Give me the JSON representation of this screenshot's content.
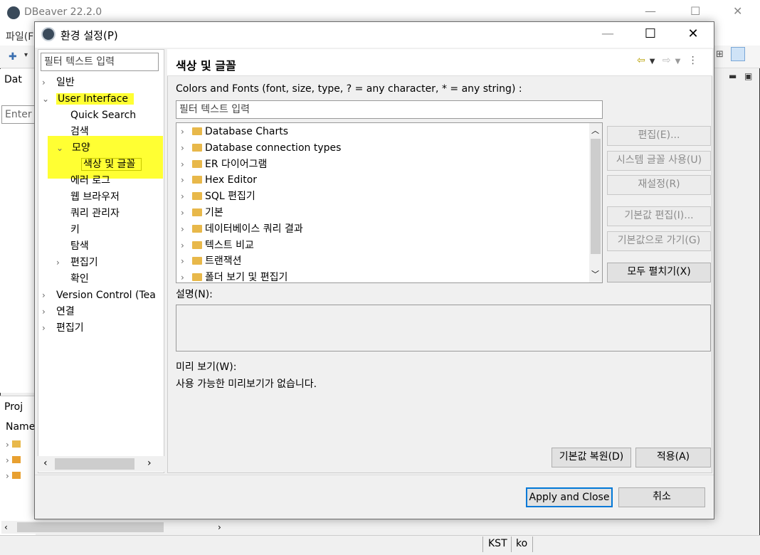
{
  "app": {
    "title": "DBeaver 22.2.0",
    "menu_file": "파일(F",
    "left_tab": "Dat",
    "left_filter_placeholder": "Enter a",
    "projects_tab": "Proj",
    "name_col": "Name",
    "status_kst": "KST",
    "status_ko": "ko"
  },
  "dialog": {
    "title": "환경 설정(P)",
    "controls": {
      "minimize": "—",
      "maximize": "☐",
      "close": "✕"
    }
  },
  "tree": {
    "filter_placeholder": "필터 텍스트 입력",
    "items": [
      {
        "label": "일반",
        "chev": "›",
        "indent": 0
      },
      {
        "label": "User Interface",
        "chev": "⌄",
        "indent": 0
      },
      {
        "label": "Quick Search",
        "chev": "",
        "indent": 1
      },
      {
        "label": "검색",
        "chev": "",
        "indent": 1
      },
      {
        "label": "모양",
        "chev": "⌄",
        "indent": 1
      },
      {
        "label": "색상 및 글꼴",
        "chev": "",
        "indent": 2
      },
      {
        "label": "에러 로그",
        "chev": "",
        "indent": 1
      },
      {
        "label": "웹 브라우저",
        "chev": "",
        "indent": 1
      },
      {
        "label": "쿼리 관리자",
        "chev": "",
        "indent": 1
      },
      {
        "label": "키",
        "chev": "",
        "indent": 1
      },
      {
        "label": "탐색",
        "chev": "",
        "indent": 1
      },
      {
        "label": "편집기",
        "chev": "›",
        "indent": 1
      },
      {
        "label": "확인",
        "chev": "",
        "indent": 1
      },
      {
        "label": "Version Control (Tea",
        "chev": "›",
        "indent": 0
      },
      {
        "label": "연결",
        "chev": "›",
        "indent": 0
      },
      {
        "label": "편집기",
        "chev": "›",
        "indent": 0
      }
    ]
  },
  "content": {
    "title": "색상 및 글꼴",
    "cf_label": "Colors and Fonts (font, size, type, ? = any character, * = any string) :",
    "cf_filter_placeholder": "필터 텍스트 입력",
    "cf_items": [
      "Database Charts",
      "Database connection types",
      "ER 다이어그램",
      "Hex Editor",
      "SQL 편집기",
      "기본",
      "데이터베이스 쿼리 결과",
      "텍스트 비교",
      "트랜잭션",
      "폴더 보기 및 편집기"
    ],
    "buttons": {
      "edit": "편집(E)...",
      "use_system_font": "시스템 글꼴 사용(U)",
      "reset": "재설정(R)",
      "edit_default": "기본값 편집(I)...",
      "go_default": "기본값으로 가기(G)",
      "expand_all": "모두 펼치기(X)"
    },
    "desc_label": "설명(N):",
    "preview_label": "미리 보기(W):",
    "preview_text": "사용 가능한 미리보기가 없습니다.",
    "restore_defaults": "기본값 복원(D)",
    "apply": "적용(A)"
  },
  "footer": {
    "apply_close": "Apply and Close",
    "cancel": "취소"
  },
  "colors": {
    "highlight": "#ffff33",
    "folder": "#e8b84a",
    "focus_border": "#0078d7"
  }
}
